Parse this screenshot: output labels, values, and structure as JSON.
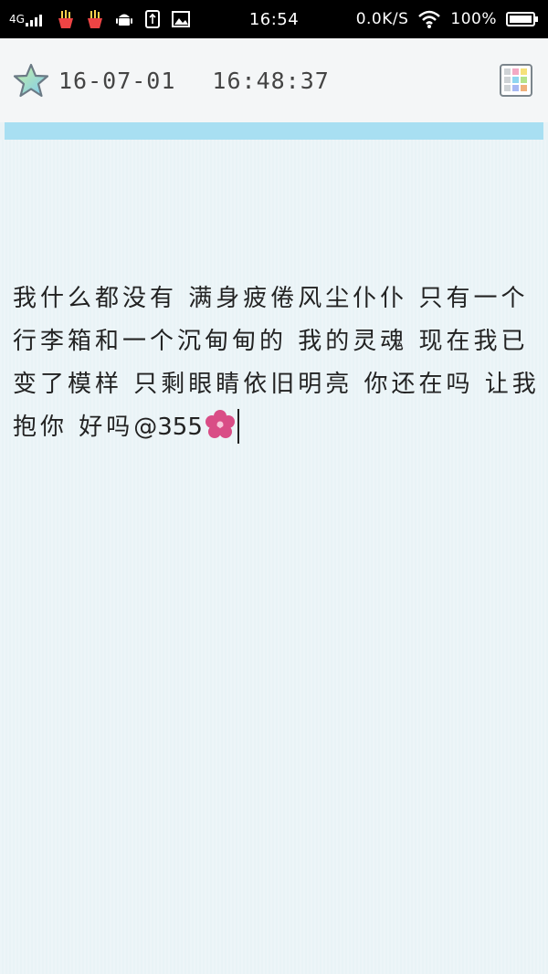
{
  "status_bar": {
    "network_type": "4G",
    "time": "16:54",
    "speed": "0.0K/S",
    "battery": "100%",
    "icons": [
      "4g-signal-icon",
      "fries-icon",
      "fries-icon",
      "android-icon",
      "usb-icon",
      "gallery-icon",
      "wifi-icon",
      "battery-icon"
    ]
  },
  "header": {
    "date": "16-07-01",
    "time": "16:48:37",
    "left_icon": "star-icon",
    "right_icon": "color-palette-icon"
  },
  "note": {
    "body": "我什么都没有 满身疲倦风尘仆仆 只有一个行李箱和一个沉甸甸的 我的灵魂 现在我已变了模样 只剩眼睛依旧明亮 你还在吗 让我抱你 好吗",
    "mention": "@355",
    "emoji": "cherry-blossom-icon"
  },
  "colors": {
    "accent_bar": "#a8dff2",
    "background": "#e9f3f6",
    "header_bg": "#f4f6f7",
    "flower": "#d94d86"
  }
}
